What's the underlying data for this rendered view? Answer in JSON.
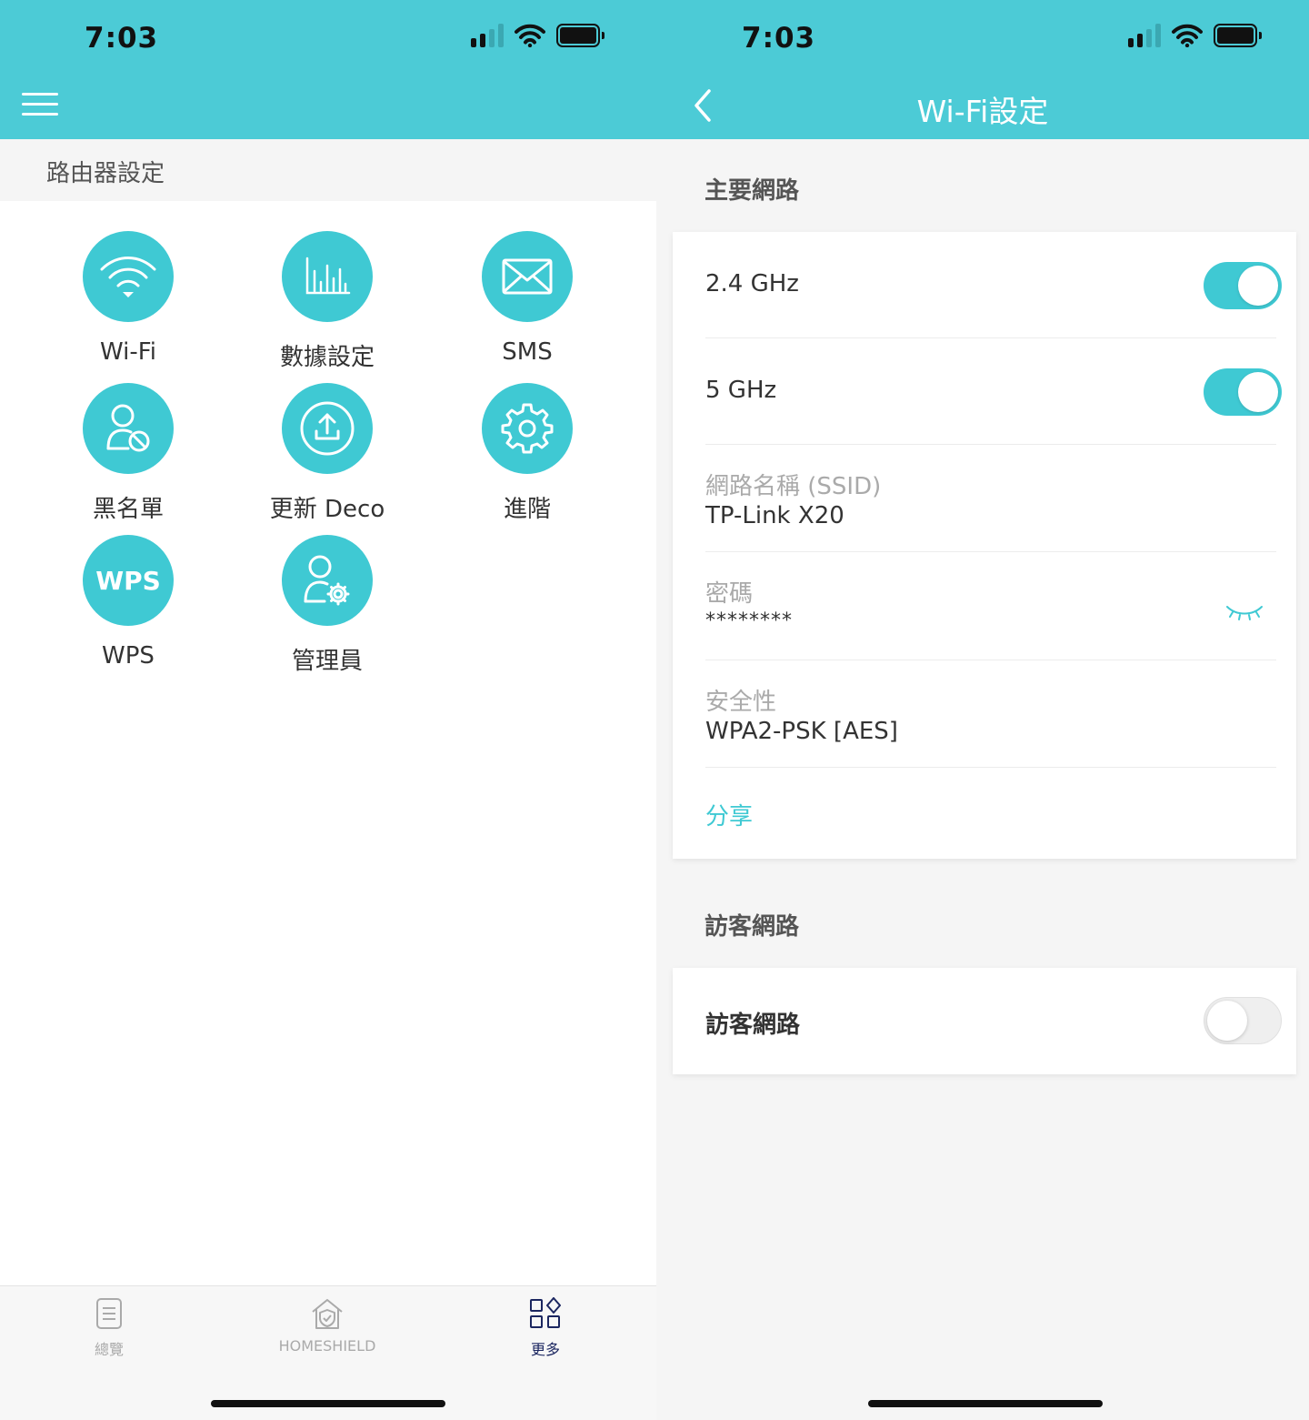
{
  "colors": {
    "accent": "#4ccbd6",
    "icon_circle": "#3fc9d3",
    "tab_active": "#1b2660"
  },
  "left": {
    "status": {
      "time": "7:03"
    },
    "section_title": "路由器設定",
    "items": [
      {
        "label": "Wi-Fi",
        "icon": "wifi-icon"
      },
      {
        "label": "數據設定",
        "icon": "bar-chart-icon"
      },
      {
        "label": "SMS",
        "icon": "envelope-icon"
      },
      {
        "label": "黑名單",
        "icon": "user-blocked-icon"
      },
      {
        "label": "更新 Deco",
        "icon": "upload-icon"
      },
      {
        "label": "進階",
        "icon": "gear-icon"
      },
      {
        "label": "WPS",
        "icon": "wps-icon",
        "icon_text": "WPS"
      },
      {
        "label": "管理員",
        "icon": "user-settings-icon"
      }
    ],
    "tabs": [
      {
        "label": "總覽",
        "icon": "document-icon"
      },
      {
        "label": "HOMESHIELD",
        "icon": "house-shield-icon"
      },
      {
        "label": "更多",
        "icon": "grid-more-icon",
        "active": true
      }
    ]
  },
  "right": {
    "status": {
      "time": "7:03"
    },
    "title": "Wi-Fi設定",
    "main_network": {
      "title": "主要網路",
      "band_24": {
        "label": "2.4 GHz",
        "on": true
      },
      "band_5": {
        "label": "5 GHz",
        "on": true
      },
      "ssid": {
        "label": "網路名稱 (SSID)",
        "value": "TP-Link X20"
      },
      "password": {
        "label": "密碼",
        "value": "********"
      },
      "security": {
        "label": "安全性",
        "value": "WPA2-PSK [AES]"
      },
      "share": "分享"
    },
    "guest_network": {
      "title": "訪客網路",
      "toggle_label": "訪客網路",
      "on": false
    }
  }
}
